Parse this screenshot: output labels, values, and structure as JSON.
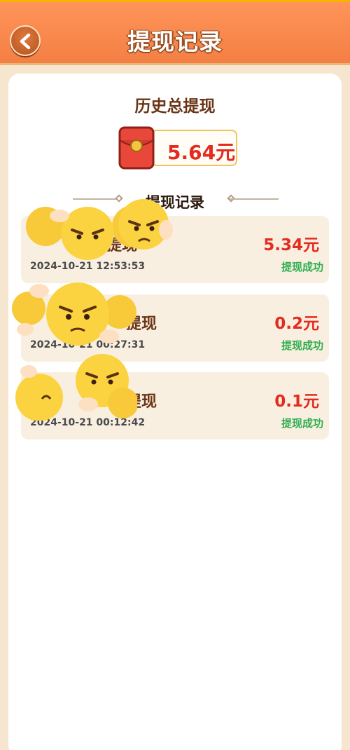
{
  "header": {
    "title": "提现记录",
    "back_icon": "chevron-left-icon"
  },
  "summary": {
    "label": "历史总提现",
    "amount": "5.64元",
    "icon": "red-envelope-icon"
  },
  "section": {
    "title": "提现记录"
  },
  "records": [
    {
      "title": "提现",
      "time": "2024-10-21 12:53:53",
      "amount": "5.34元",
      "status": "提现成功"
    },
    {
      "title": "提现",
      "time": "2024-10-21 00:27:31",
      "amount": "0.2元",
      "status": "提现成功"
    },
    {
      "title": "提现",
      "time": "2024-10-21 00:12:42",
      "amount": "0.1元",
      "status": "提现成功"
    }
  ],
  "colors": {
    "header": "#f47f44",
    "background": "#f7e6cf",
    "amount": "#e32b1f",
    "status": "#2fae4f",
    "title_brown": "#6a3515"
  }
}
